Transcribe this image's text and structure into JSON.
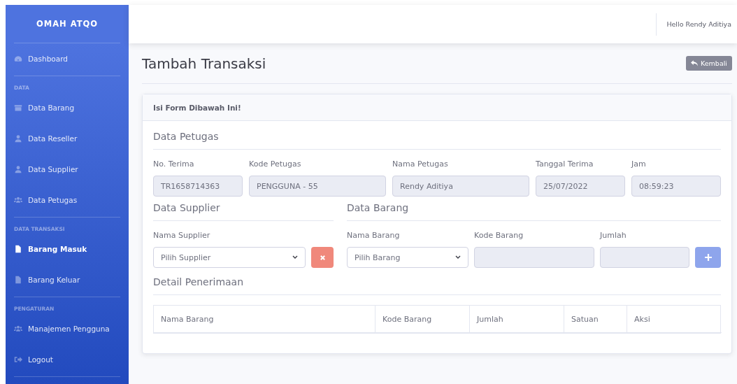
{
  "sidebar": {
    "brand": "OMAH ATQO",
    "sections": [
      {
        "items": [
          {
            "label": "Dashboard",
            "selected": false
          }
        ]
      },
      {
        "heading": "DATA",
        "items": [
          {
            "label": "Data Barang",
            "selected": false
          },
          {
            "label": "Data Reseller",
            "selected": false
          },
          {
            "label": "Data Supplier",
            "selected": false
          },
          {
            "label": "Data Petugas",
            "selected": false
          }
        ]
      },
      {
        "heading": "DATA TRANSAKSI",
        "items": [
          {
            "label": "Barang Masuk",
            "selected": true
          },
          {
            "label": "Barang Keluar",
            "selected": false
          }
        ]
      },
      {
        "heading": "PENGATURAN",
        "items": [
          {
            "label": "Manajemen Pengguna",
            "selected": false
          },
          {
            "label": "Logout",
            "selected": false
          }
        ]
      }
    ]
  },
  "topbar": {
    "user": "Hello Rendy Aditiya"
  },
  "page": {
    "title": "Tambah Transaksi",
    "back_button": "Kembali"
  },
  "card": {
    "header": "Isi Form Dibawah Ini!",
    "petugas": {
      "title": "Data Petugas",
      "fields": [
        {
          "label": "No. Terima",
          "value": "TR1658714363"
        },
        {
          "label": "Kode Petugas",
          "value": "PENGGUNA - 55"
        },
        {
          "label": "Nama Petugas",
          "value": "Rendy Aditiya"
        },
        {
          "label": "Tanggal Terima",
          "value": "25/07/2022"
        },
        {
          "label": "Jam",
          "value": "08:59:23"
        }
      ]
    },
    "supplier": {
      "title": "Data Supplier",
      "label": "Nama Supplier",
      "select": "Pilih Supplier"
    },
    "barang": {
      "title": "Data Barang",
      "name_label": "Nama Barang",
      "select": "Pilih Barang",
      "code_label": "Kode Barang",
      "qty_label": "Jumlah"
    },
    "detail": {
      "title": "Detail Penerimaan",
      "columns": [
        "Nama Barang",
        "Kode Barang",
        "Jumlah",
        "Satuan",
        "Aksi"
      ]
    }
  }
}
